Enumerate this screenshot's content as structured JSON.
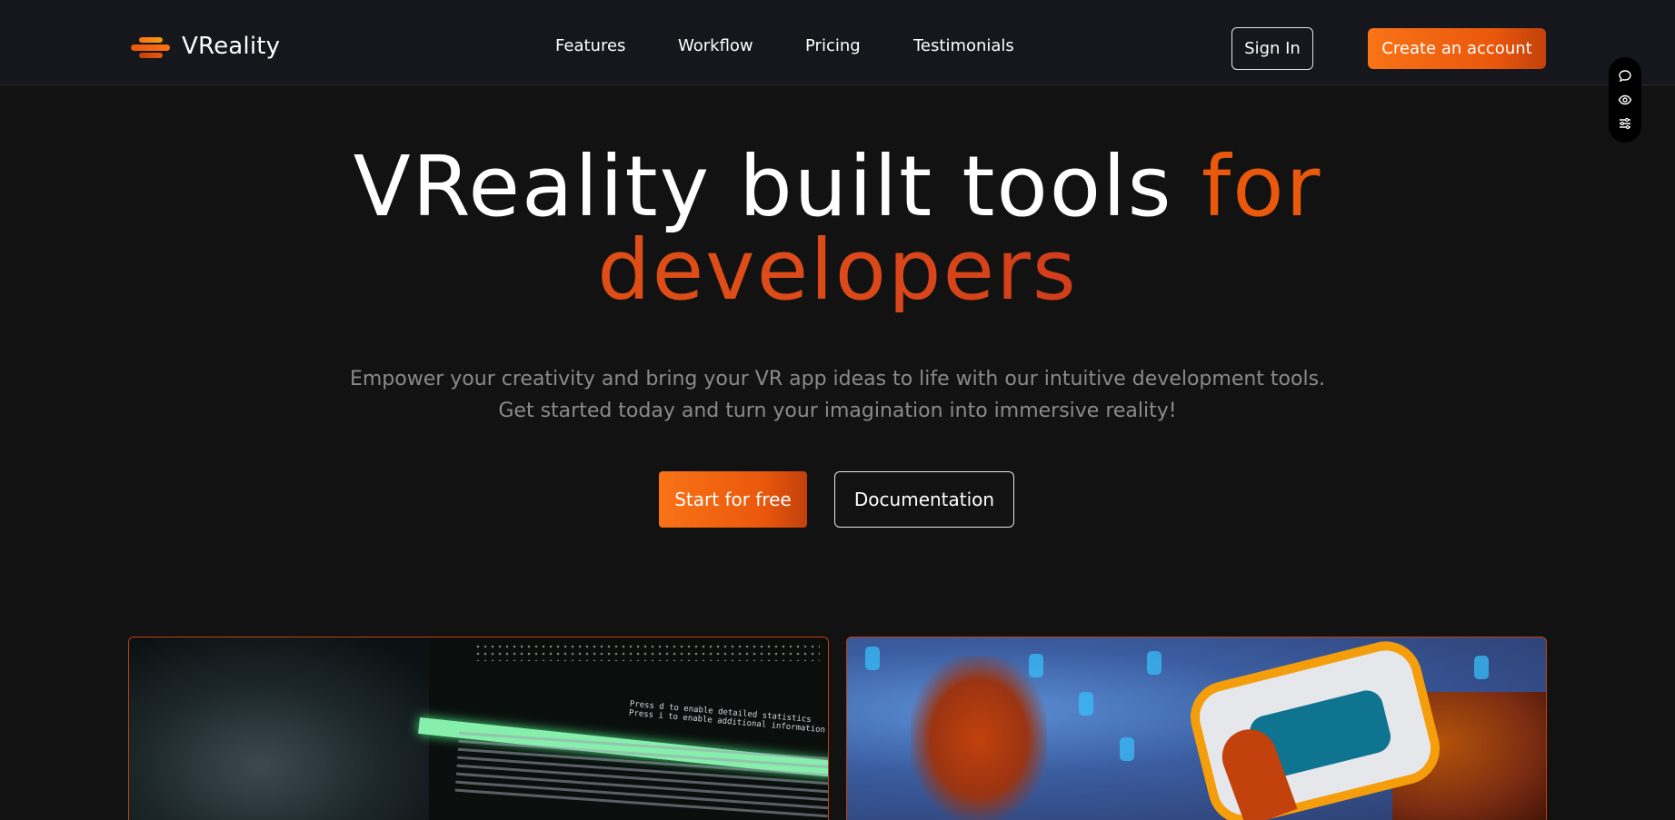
{
  "app": {
    "brand": "VReality"
  },
  "nav": {
    "items": [
      {
        "label": "Features"
      },
      {
        "label": "Workflow"
      },
      {
        "label": "Pricing"
      },
      {
        "label": "Testimonials"
      }
    ]
  },
  "header": {
    "sign_in": "Sign In",
    "create_account": "Create an account"
  },
  "side_tools": {
    "icons": [
      "comment-icon",
      "eye-icon",
      "sliders-icon"
    ]
  },
  "hero": {
    "title_white": "VReality built tools ",
    "title_orange": "for",
    "title_line2": "developers",
    "subtitle_line1": "Empower your creativity and bring your VR app ideas to life with our intuitive development tools.",
    "subtitle_line2": "Get started today and turn your imagination into immersive reality!",
    "cta_primary": "Start for free",
    "cta_secondary": "Documentation"
  },
  "media": {
    "left_label": "Press d to enable detailed statistics",
    "left_label2": "Press i to enable additional information"
  },
  "colors": {
    "accent": "#ea580c",
    "accent_light": "#f97316",
    "background": "#121212",
    "header_bg": "#16161d"
  }
}
